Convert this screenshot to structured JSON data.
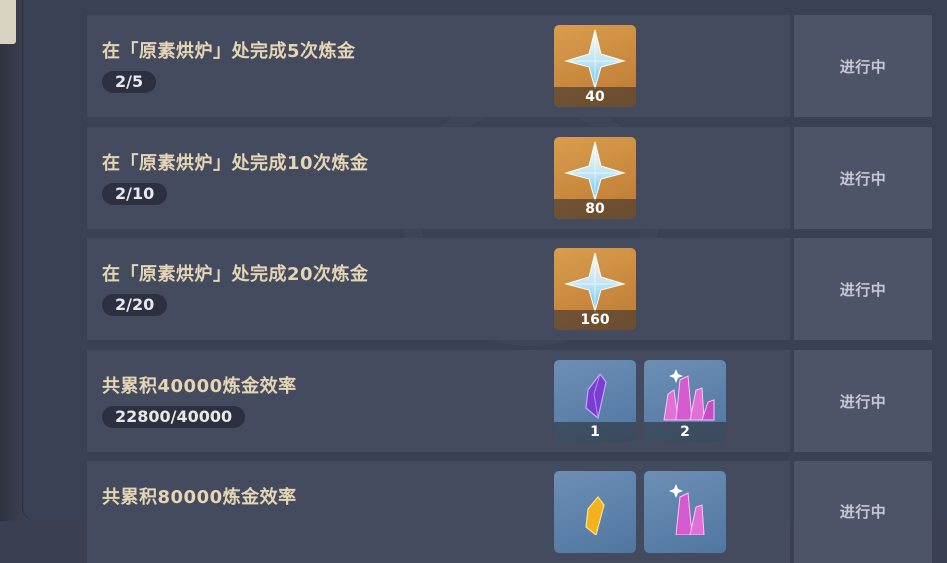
{
  "tasks": [
    {
      "title": "在「原素烘炉」处完成5次炼金",
      "progress": "2/5",
      "status": "进行中",
      "rewards": [
        {
          "icon": "primogem-icon",
          "qty": "40"
        }
      ]
    },
    {
      "title": "在「原素烘炉」处完成10次炼金",
      "progress": "2/10",
      "status": "进行中",
      "rewards": [
        {
          "icon": "primogem-icon",
          "qty": "80"
        }
      ]
    },
    {
      "title": "在「原素烘炉」处完成20次炼金",
      "progress": "2/20",
      "status": "进行中",
      "rewards": [
        {
          "icon": "primogem-icon",
          "qty": "160"
        }
      ]
    },
    {
      "title": "共累积40000炼金效率",
      "progress": "22800/40000",
      "status": "进行中",
      "rewards": [
        {
          "icon": "purple-crystal-icon",
          "qty": "1"
        },
        {
          "icon": "pink-crystal-cluster-icon",
          "qty": "2"
        }
      ]
    },
    {
      "title": "共累积80000炼金效率",
      "progress": "",
      "status": "进行中",
      "rewards": [
        {
          "icon": "gold-crystal-icon",
          "qty": ""
        },
        {
          "icon": "pink-crystal-cluster-icon",
          "qty": ""
        }
      ]
    }
  ]
}
